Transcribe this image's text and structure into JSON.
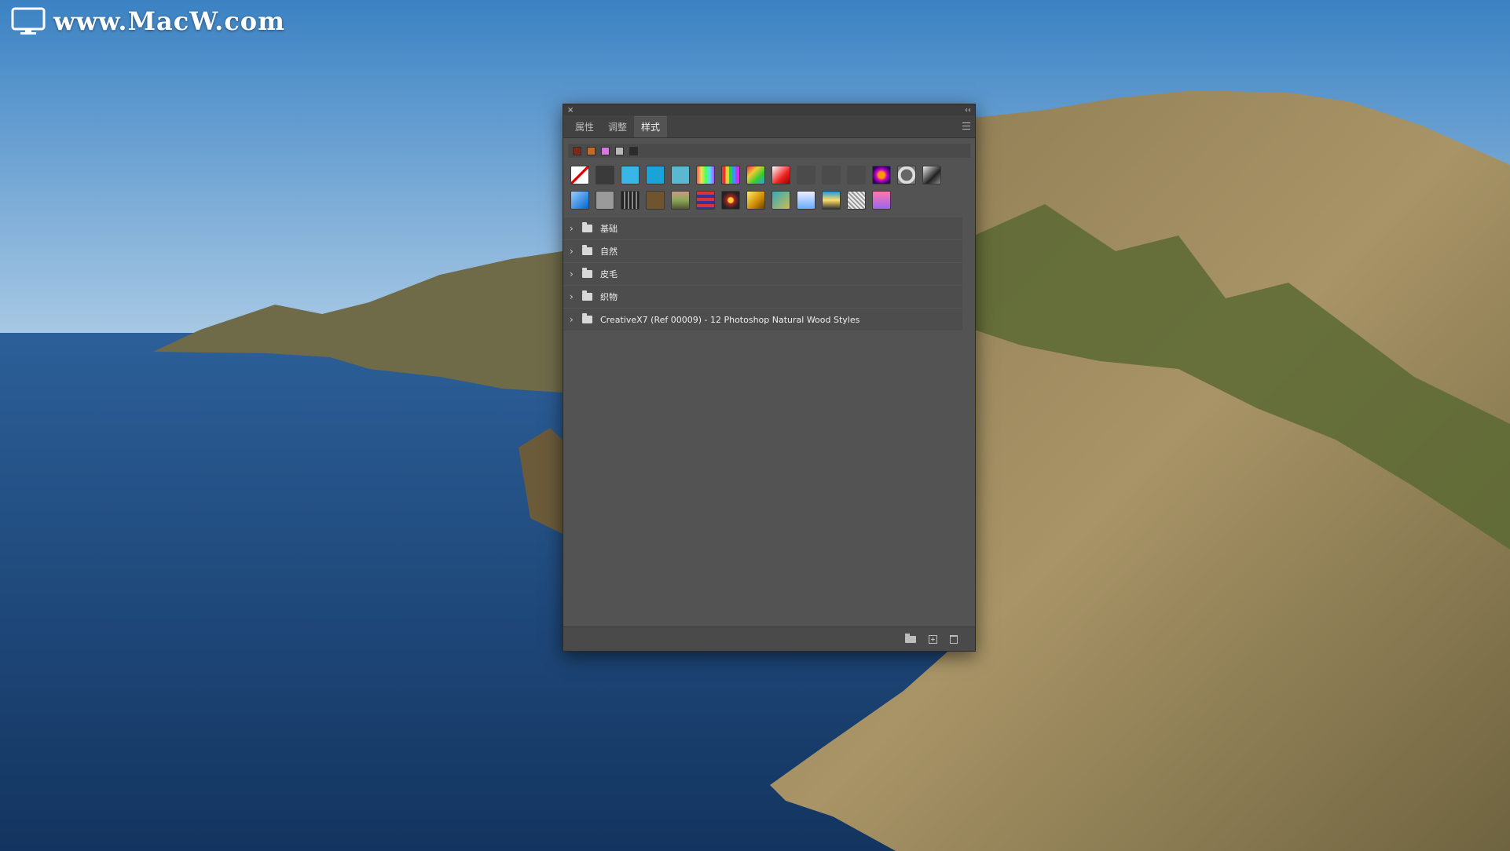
{
  "watermark": {
    "text": "www.MacW.com"
  },
  "panel": {
    "close_glyph": "×",
    "collapse_glyph": "‹‹",
    "tabs": [
      {
        "label": "属性",
        "active": false
      },
      {
        "label": "调整",
        "active": false
      },
      {
        "label": "样式",
        "active": true
      }
    ],
    "recent_swatches": [
      "#7a2a1a",
      "#c36a2a",
      "#d27bd8",
      "#b9b9b9",
      "#2b2b2b"
    ],
    "style_swatches": [
      "none",
      "#3a3a3a",
      "#38b6e6",
      "#1aa3d8",
      "#5ab8d0",
      "rainbow",
      "rainbow-vert",
      "rainbow-box",
      "red-grad",
      "dark",
      "dark",
      "dark",
      "purple-orb",
      "frame",
      "chrome",
      "blue-glass",
      "#9a9a9a",
      "film",
      "#6e5530",
      "wood",
      "stripes",
      "floral",
      "gold",
      "teal-gold",
      "sky",
      "sunset",
      "sketch",
      "violet"
    ],
    "folders": [
      {
        "label": "基础"
      },
      {
        "label": "自然"
      },
      {
        "label": "皮毛"
      },
      {
        "label": "织物"
      },
      {
        "label": "CreativeX7 (Ref 00009) - 12 Photoshop Natural Wood Styles"
      }
    ],
    "footer_icons": [
      "folder-icon",
      "new-style-icon",
      "trash-icon"
    ]
  }
}
